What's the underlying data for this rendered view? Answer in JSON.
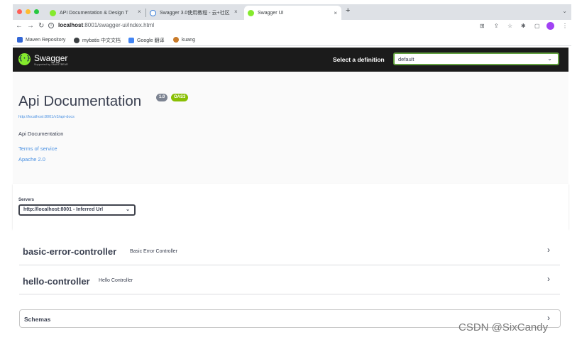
{
  "browser": {
    "tabs": [
      {
        "title": "API Documentation & Design T"
      },
      {
        "title": "Swagger 3.0使用教程 - 云+社区"
      },
      {
        "title": "Swagger UI"
      }
    ],
    "new_tab": "+",
    "tab_close": "×",
    "tab_menu": "⌄",
    "address": {
      "host": "localhost",
      "path": ":8001/swagger-ui/index.html"
    },
    "bookmarks": [
      {
        "label": "Maven Repository"
      },
      {
        "label": "mybatis 中文文档"
      },
      {
        "label": "Google 翻译"
      },
      {
        "label": "kuang"
      }
    ],
    "colors": {
      "traffic": [
        "#ff5f57",
        "#febc2e",
        "#28c840"
      ],
      "tab_favicon": "#85ea2d"
    }
  },
  "topbar": {
    "logo_text": "Swagger",
    "logo_sub": "Supported by SMARTBEAR",
    "definition_label": "Select a definition",
    "definition_value": "default"
  },
  "info": {
    "title": "Api Documentation",
    "version": "1.0",
    "oas": "OAS3",
    "spec_link": "http://localhost:8001/v3/api-docs",
    "description": "Api Documentation",
    "terms": "Terms of service",
    "license": "Apache 2.0"
  },
  "servers": {
    "label": "Servers",
    "selected": "http://localhost:8001 - Inferred Url"
  },
  "tags": [
    {
      "name": "basic-error-controller",
      "description": "Basic Error Controller"
    },
    {
      "name": "hello-controller",
      "description": "Hello Controller"
    }
  ],
  "schemas": {
    "label": "Schemas"
  },
  "watermark": "CSDN @SixCandy",
  "colors": {
    "topbar_bg": "#1b1b1b",
    "accent_green": "#85ea2d",
    "select_border": "#62a03f",
    "link": "#4990e2",
    "oas_badge": "#89bf04",
    "version_badge": "#7d8492"
  }
}
